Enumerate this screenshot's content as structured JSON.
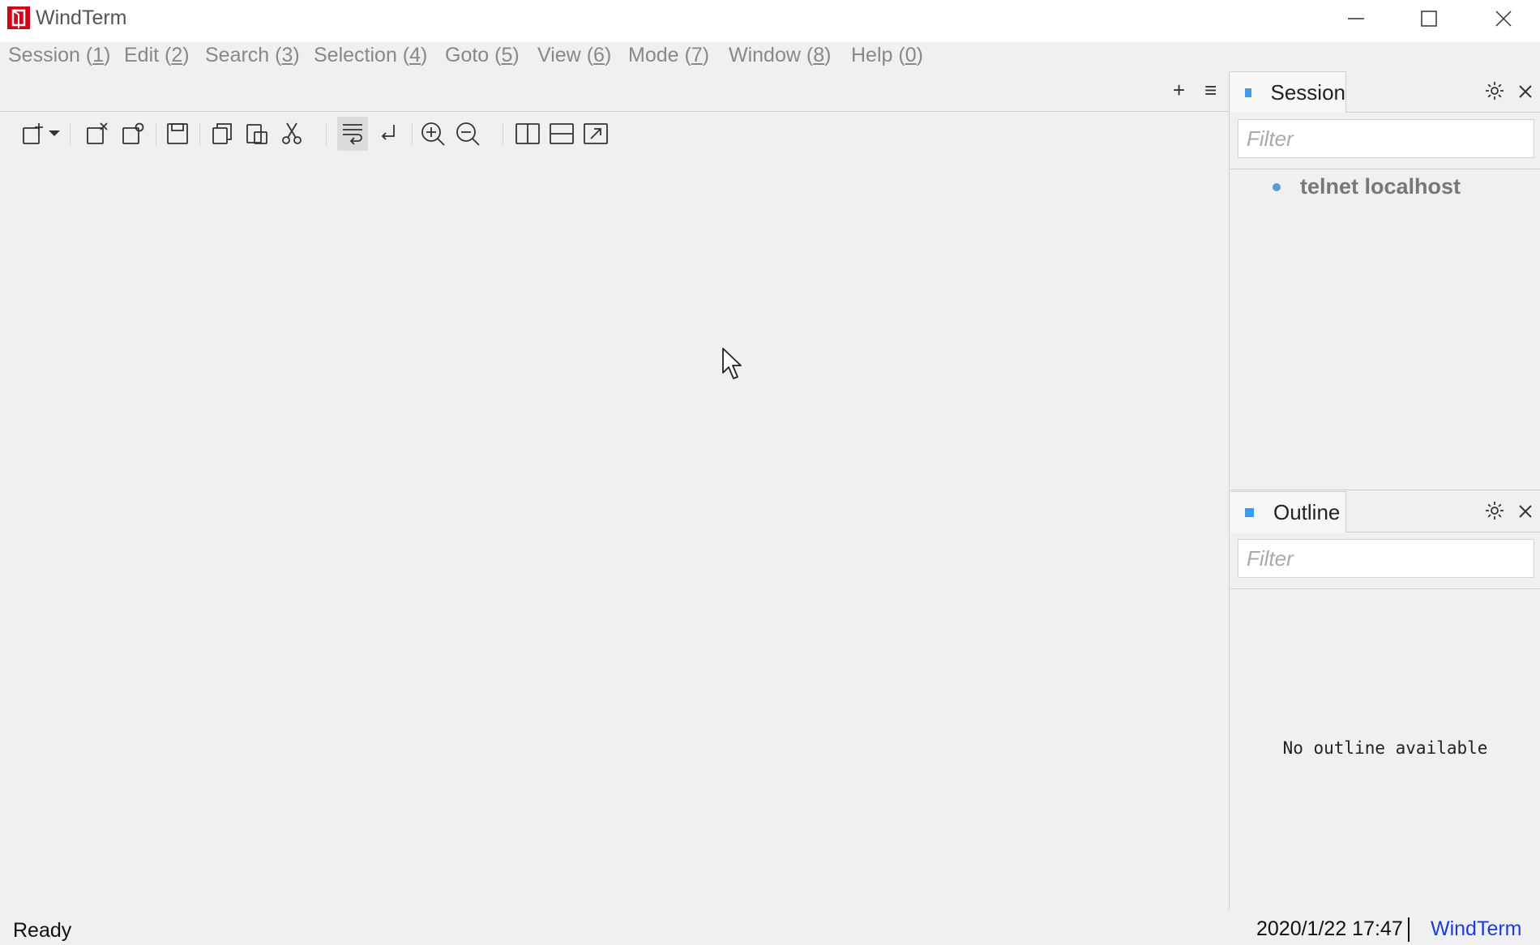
{
  "window": {
    "title": "WindTerm",
    "logo_color": "#d0021b"
  },
  "menu": [
    {
      "label": "Session",
      "key": "1"
    },
    {
      "label": "Edit",
      "key": "2"
    },
    {
      "label": "Search",
      "key": "3"
    },
    {
      "label": "Selection",
      "key": "4"
    },
    {
      "label": "Goto",
      "key": "5"
    },
    {
      "label": "View",
      "key": "6"
    },
    {
      "label": "Mode",
      "key": "7"
    },
    {
      "label": "Window",
      "key": "8"
    },
    {
      "label": "Help",
      "key": "0"
    }
  ],
  "tab_actions": {
    "add": "+",
    "list": "≡"
  },
  "toolbar": [
    "new-session-icon",
    "dropdown-arrow-icon",
    "close-session-icon",
    "duplicate-session-icon",
    "save-icon",
    "copy-icon",
    "paste-icon",
    "cut-icon",
    "word-wrap-icon",
    "carriage-return-icon",
    "zoom-in-icon",
    "zoom-out-icon",
    "split-vertical-icon",
    "split-horizontal-icon",
    "pop-out-icon"
  ],
  "session_panel": {
    "title": "Session",
    "filter_placeholder": "Filter",
    "items": [
      {
        "label": "telnet localhost"
      }
    ]
  },
  "outline_panel": {
    "title": "Outline",
    "filter_placeholder": "Filter",
    "empty_message": "No outline available"
  },
  "status": {
    "text": "Ready",
    "datetime": "2020/1/22 17:47",
    "app_name": "WindTerm"
  },
  "colors": {
    "accent": "#3c9cf0",
    "status_link": "#1a3ddb"
  }
}
